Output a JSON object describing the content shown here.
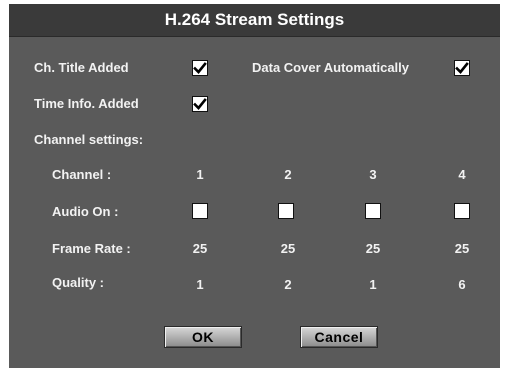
{
  "dialog": {
    "title": "H.264 Stream Settings"
  },
  "options": {
    "ch_title_added": {
      "label": "Ch. Title Added",
      "checked": true
    },
    "data_cover_automatically": {
      "label": "Data Cover Automatically",
      "checked": true
    },
    "time_info_added": {
      "label": "Time Info. Added",
      "checked": true
    }
  },
  "channel_settings": {
    "heading": "Channel settings:",
    "labels": {
      "channel": "Channel :",
      "audio_on": "Audio On :",
      "frame_rate": "Frame Rate :",
      "quality": "Quality :"
    },
    "channels": [
      {
        "number": "1",
        "audio_on": false,
        "frame_rate": "25",
        "quality": "1"
      },
      {
        "number": "2",
        "audio_on": false,
        "frame_rate": "25",
        "quality": "2"
      },
      {
        "number": "3",
        "audio_on": false,
        "frame_rate": "25",
        "quality": "1"
      },
      {
        "number": "4",
        "audio_on": false,
        "frame_rate": "25",
        "quality": "6"
      }
    ]
  },
  "buttons": {
    "ok": "OK",
    "cancel": "Cancel"
  },
  "colors": {
    "dialog_bg": "#5a5a5a",
    "titlebar_bg": "#3a3a3a",
    "text": "#f2f2f2"
  }
}
